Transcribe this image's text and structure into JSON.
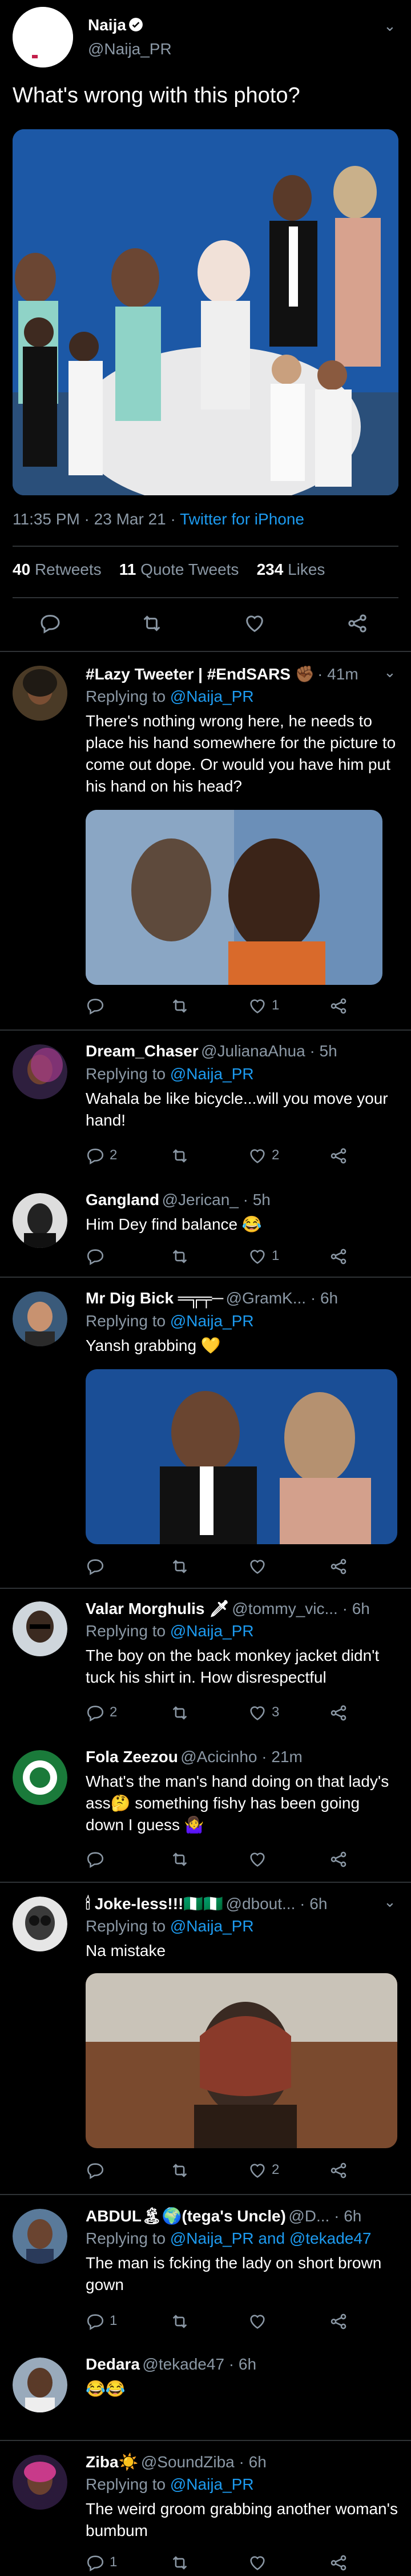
{
  "main": {
    "name": "Naija",
    "handle": "@Naija_PR",
    "text": "What's wrong with this photo?",
    "time": "11:35 PM · 23 Mar 21 · ",
    "source": "Twitter for iPhone",
    "stats": {
      "retweets_num": "40",
      "retweets_label": "Retweets",
      "quotes_num": "11",
      "quotes_label": "Quote Tweets",
      "likes_num": "234",
      "likes_label": "Likes"
    }
  },
  "replies": [
    {
      "name": "#Lazy Tweeter | #EndSARS ✊🏾",
      "meta": "· 41m",
      "replying": "Replying to ",
      "replying_to": "@Naija_PR",
      "text": "There's nothing wrong here, he needs to place his hand somewhere for the picture to come out dope. Or would you have him put his hand on his head?",
      "likes": "1",
      "replies": "",
      "retweets": ""
    },
    {
      "name": "Dream_Chaser",
      "meta": "@JulianaAhua · 5h",
      "replying": "Replying to ",
      "replying_to": "@Naija_PR",
      "text": "Wahala be like bicycle...will you move your hand!",
      "replies": "2",
      "retweets": "",
      "likes": "2"
    },
    {
      "name": "Gangland",
      "meta": "@Jerican_ · 5h",
      "text": "Him Dey find balance 😂",
      "likes": "1"
    },
    {
      "name": "Mr Dig Bick ═╦╤─",
      "meta": "@GramK... · 6h",
      "replying": "Replying to ",
      "replying_to": "@Naija_PR",
      "text": "Yansh grabbing 💛"
    },
    {
      "name": "Valar Morghulis 🗡",
      "meta": "@tommy_vic... · 6h",
      "replying": "Replying to ",
      "replying_to": "@Naija_PR",
      "text": "The boy on the back monkey jacket didn't tuck his shirt in. How disrespectful",
      "replies": "2",
      "likes": "3"
    },
    {
      "name": "Fola Zeezou",
      "meta": "@Acicinho · 21m",
      "text": "What's the man's hand doing on that lady's ass🤔 something fishy has been going down I guess 🤷‍♀️"
    },
    {
      "name": "🕯 Joke-less!!!🇳🇬🇳🇬",
      "meta": "@dbout... · 6h",
      "replying": "Replying to ",
      "replying_to": "@Naija_PR",
      "text": "Na mistake",
      "likes": "2"
    },
    {
      "name": "ABDUL🏝🌍(tega's Uncle)",
      "meta": "@D... · 6h",
      "replying": "Replying to ",
      "replying_to": "@Naija_PR and @tekade47",
      "text": "The man is fcking the lady on short brown gown",
      "replies": "1"
    },
    {
      "name": "Dedara",
      "meta": "@tekade47 · 6h",
      "text": "😂😂"
    },
    {
      "name": "Ziba☀️",
      "meta": "@SoundZiba · 6h",
      "replying": "Replying to ",
      "replying_to": "@Naija_PR",
      "text": "The weird groom grabbing another woman's bumbum",
      "replies": "1"
    }
  ],
  "colors": {
    "accent": "#1d9bf0",
    "muted": "#8b98a5",
    "bg": "#000000",
    "divider": "#2f3336"
  }
}
